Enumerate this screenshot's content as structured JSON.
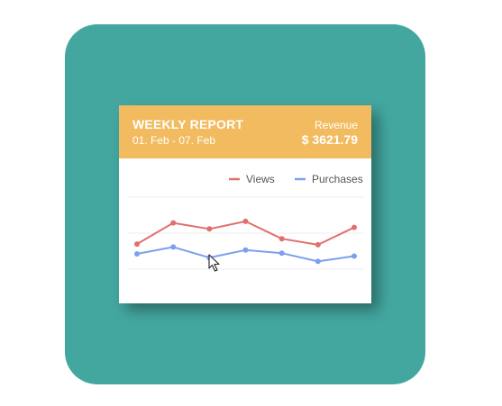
{
  "header": {
    "title": "WEEKLY REPORT",
    "date_range": "01. Feb - 07. Feb",
    "revenue_label": "Revenue",
    "revenue_value": "$ 3621.79"
  },
  "colors": {
    "tile": "#43a7a0",
    "header": "#f2bb60",
    "views": "#e0706e",
    "purchases": "#7c9fef"
  },
  "icons": {
    "cursor": "mouse-pointer-icon"
  },
  "chart_data": {
    "type": "line",
    "x": [
      1,
      2,
      3,
      4,
      5,
      6,
      7
    ],
    "series": [
      {
        "name": "Views",
        "values": [
          38,
          66,
          58,
          68,
          45,
          37,
          60
        ]
      },
      {
        "name": "Purchases",
        "values": [
          25,
          34,
          20,
          30,
          26,
          15,
          22
        ]
      }
    ],
    "ylim": [
      0,
      100
    ],
    "legend_position": "top-right",
    "grid": true
  }
}
